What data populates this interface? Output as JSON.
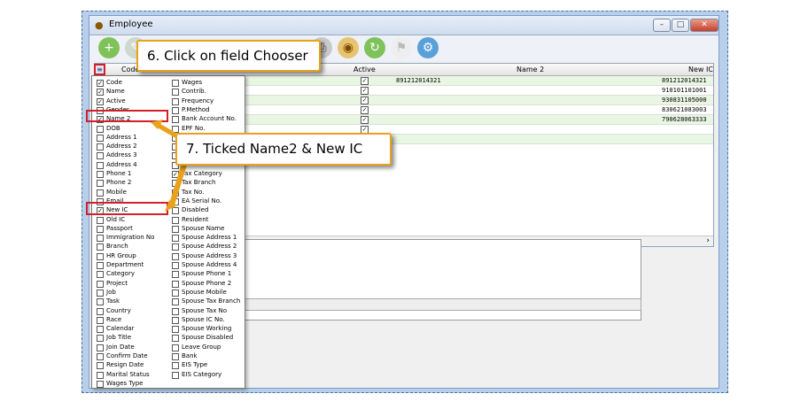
{
  "window": {
    "title": "Employee"
  },
  "callouts": {
    "step6": "6. Click on field Chooser",
    "step7": "7. Ticked Name2 & New IC"
  },
  "grid": {
    "columns": [
      "Code",
      "Name",
      "Active",
      "Name 2",
      "New IC"
    ],
    "rows": [
      {
        "name2": "891212014321",
        "newic": "891212014321",
        "active": true
      },
      {
        "name2": "",
        "newic": "910101101001",
        "active": true
      },
      {
        "name2": "",
        "newic": "930831105000",
        "active": true
      },
      {
        "name2": "",
        "newic": "830621083003",
        "active": true
      },
      {
        "name2": "",
        "newic": "790628063333",
        "active": true
      },
      {
        "name2": "",
        "newic": "",
        "active": true
      }
    ]
  },
  "chooser": {
    "left": [
      {
        "label": "Code",
        "checked": true
      },
      {
        "label": "Name",
        "checked": true
      },
      {
        "label": "Active",
        "checked": true
      },
      {
        "label": "Gender",
        "checked": false
      },
      {
        "label": "Name 2",
        "checked": true
      },
      {
        "label": "DOB",
        "checked": false
      },
      {
        "label": "Address 1",
        "checked": false
      },
      {
        "label": "Address 2",
        "checked": false
      },
      {
        "label": "Address 3",
        "checked": false
      },
      {
        "label": "Address 4",
        "checked": false
      },
      {
        "label": "Phone 1",
        "checked": false
      },
      {
        "label": "Phone 2",
        "checked": false
      },
      {
        "label": "Mobile",
        "checked": false
      },
      {
        "label": "Email",
        "checked": false
      },
      {
        "label": "New IC",
        "checked": true
      },
      {
        "label": "Old IC",
        "checked": false
      },
      {
        "label": "Passport",
        "checked": false
      },
      {
        "label": "Immigration No",
        "checked": false
      },
      {
        "label": "Branch",
        "checked": false
      },
      {
        "label": "HR Group",
        "checked": false
      },
      {
        "label": "Department",
        "checked": false
      },
      {
        "label": "Category",
        "checked": false
      },
      {
        "label": "Project",
        "checked": false
      },
      {
        "label": "Job",
        "checked": false
      },
      {
        "label": "Task",
        "checked": false
      },
      {
        "label": "Country",
        "checked": false
      },
      {
        "label": "Race",
        "checked": false
      },
      {
        "label": "Calendar",
        "checked": false
      },
      {
        "label": "Job Title",
        "checked": false
      },
      {
        "label": "Join Date",
        "checked": false
      },
      {
        "label": "Confirm Date",
        "checked": false
      },
      {
        "label": "Resign Date",
        "checked": false
      },
      {
        "label": "Marital Status",
        "checked": false
      },
      {
        "label": "Wages Type",
        "checked": false
      }
    ],
    "right": [
      {
        "label": "Wages",
        "checked": false
      },
      {
        "label": "Contrib.",
        "checked": false
      },
      {
        "label": "Frequency",
        "checked": false
      },
      {
        "label": "P.Method",
        "checked": false
      },
      {
        "label": "Bank Account No.",
        "checked": false
      },
      {
        "label": "EPF No.",
        "checked": false
      },
      {
        "label": "",
        "checked": false
      },
      {
        "label": "",
        "checked": false
      },
      {
        "label": "",
        "checked": false
      },
      {
        "label": "",
        "checked": false
      },
      {
        "label": "Tax Category",
        "checked": true
      },
      {
        "label": "Tax Branch",
        "checked": false
      },
      {
        "label": "Tax No.",
        "checked": false
      },
      {
        "label": "EA Serial No.",
        "checked": false
      },
      {
        "label": "Disabled",
        "checked": false
      },
      {
        "label": "Resident",
        "checked": false
      },
      {
        "label": "Spouse Name",
        "checked": false
      },
      {
        "label": "Spouse Address 1",
        "checked": false
      },
      {
        "label": "Spouse Address 2",
        "checked": false
      },
      {
        "label": "Spouse Address 3",
        "checked": false
      },
      {
        "label": "Spouse Address 4",
        "checked": false
      },
      {
        "label": "Spouse Phone 1",
        "checked": false
      },
      {
        "label": "Spouse Phone 2",
        "checked": false
      },
      {
        "label": "Spouse Mobile",
        "checked": false
      },
      {
        "label": "Spouse Tax Branch",
        "checked": false
      },
      {
        "label": "Spouse Tax No",
        "checked": false
      },
      {
        "label": "Spouse IC No.",
        "checked": false
      },
      {
        "label": "Spouse Working",
        "checked": false
      },
      {
        "label": "Spouse Disabled",
        "checked": false
      },
      {
        "label": "Leave Group",
        "checked": false
      },
      {
        "label": "Bank",
        "checked": false
      },
      {
        "label": "EIS Type",
        "checked": false
      },
      {
        "label": "EIS Category",
        "checked": false
      }
    ]
  },
  "colors": {
    "highlight": "#d1202a",
    "callout_border": "#e9a21c",
    "grid_row": "#e9f6e4"
  }
}
